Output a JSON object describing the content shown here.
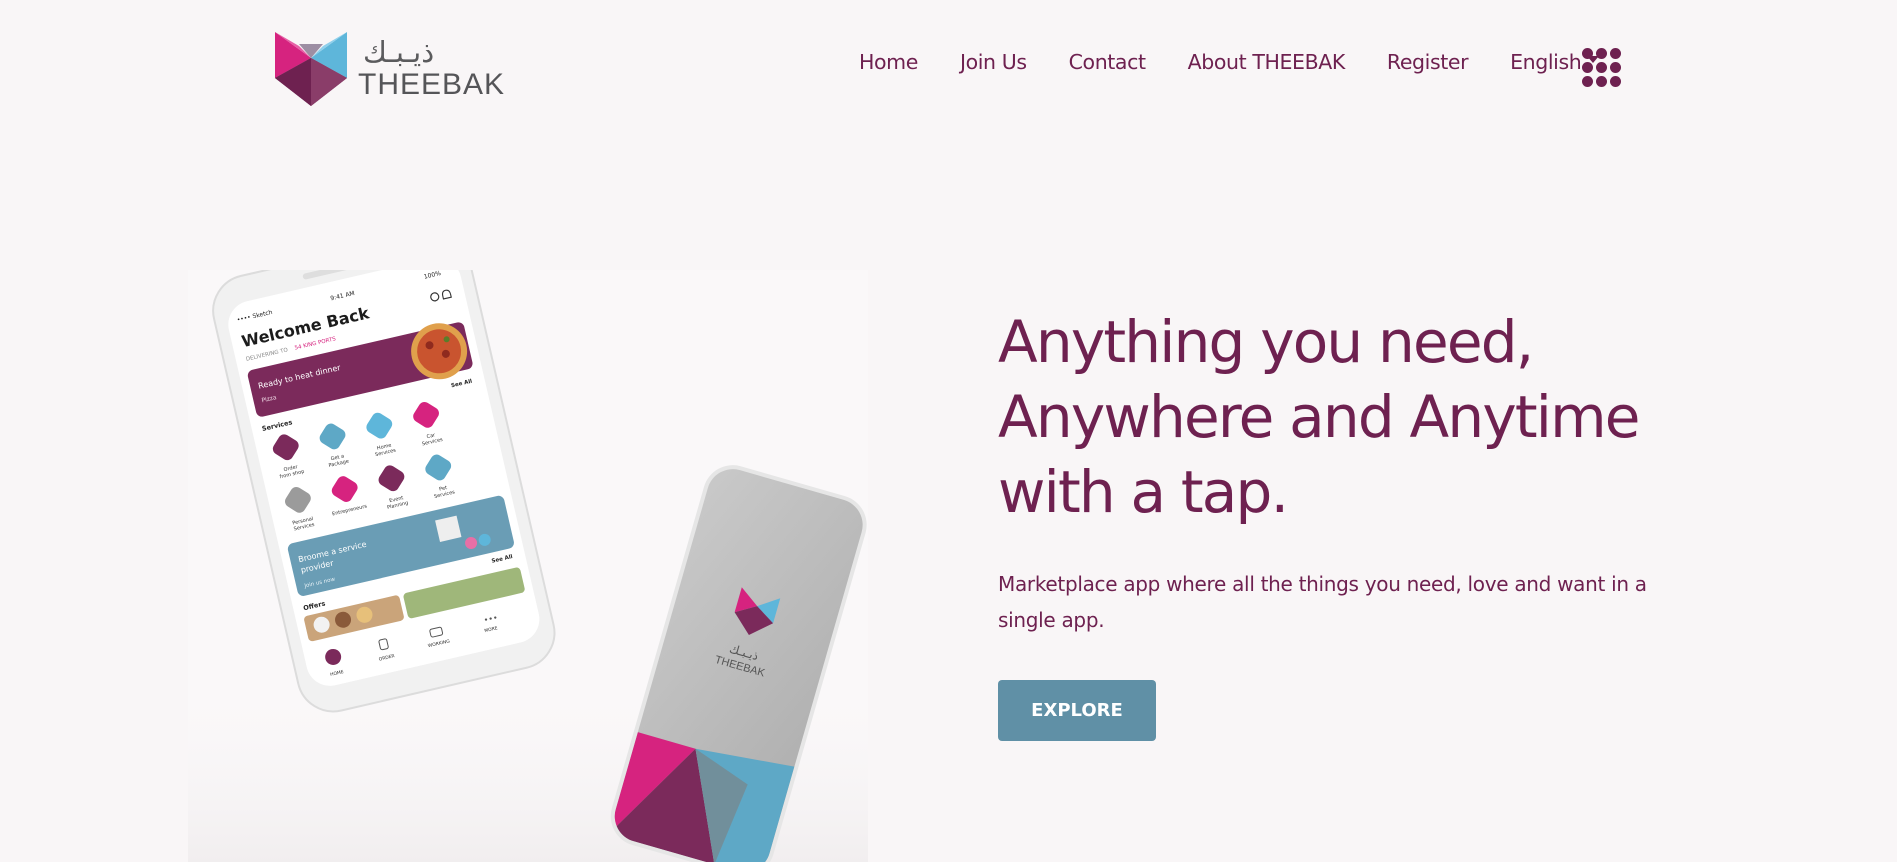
{
  "brand": {
    "arabic_name": "ذيـبـك",
    "name": "THEEBAK",
    "colors": {
      "primary": "#6e2150",
      "magenta": "#d6237f",
      "sky": "#5eb6da",
      "button": "#6090a6",
      "background": "#f9f6f7"
    }
  },
  "nav": {
    "items": [
      "Home",
      "Join Us",
      "Contact",
      "About THEEBAK",
      "Register"
    ],
    "language": "English",
    "apps_icon": "grid-dots-icon"
  },
  "hero": {
    "title_lines": [
      "Anything you need,",
      "Anywhere and Anytime",
      "with a tap."
    ],
    "subtitle": "Marketplace app where all the things you need, love and want in a single app.",
    "cta": "EXPLORE"
  },
  "phone_screen": {
    "status_carrier": "•••• Sketch",
    "status_time": "9:41 AM",
    "status_battery": "100%",
    "greeting": "Welcome Back",
    "delivering_prefix": "DELIVERING TO",
    "delivering_place": "54 KING PORTS",
    "banner_title": "Ready to heat dinner",
    "banner_tag": "Pizza",
    "services_label": "Services",
    "see_all": "See All",
    "services": [
      [
        "Order",
        "from shop"
      ],
      [
        "Get a",
        "Package"
      ],
      [
        "Home",
        "Services"
      ],
      [
        "Car",
        "Services"
      ],
      [
        "Personal",
        "Services"
      ],
      [
        "Entrepreneurs"
      ],
      [
        "Event",
        "Planning"
      ],
      [
        "Pet",
        "Services"
      ]
    ],
    "provider_title_1": "Broome a service",
    "provider_title_2": "provider",
    "provider_cta": "Join us now",
    "offers_label": "Offers",
    "tabbar": [
      "HOME",
      "ORDER",
      "WORKING",
      "MORE"
    ]
  }
}
